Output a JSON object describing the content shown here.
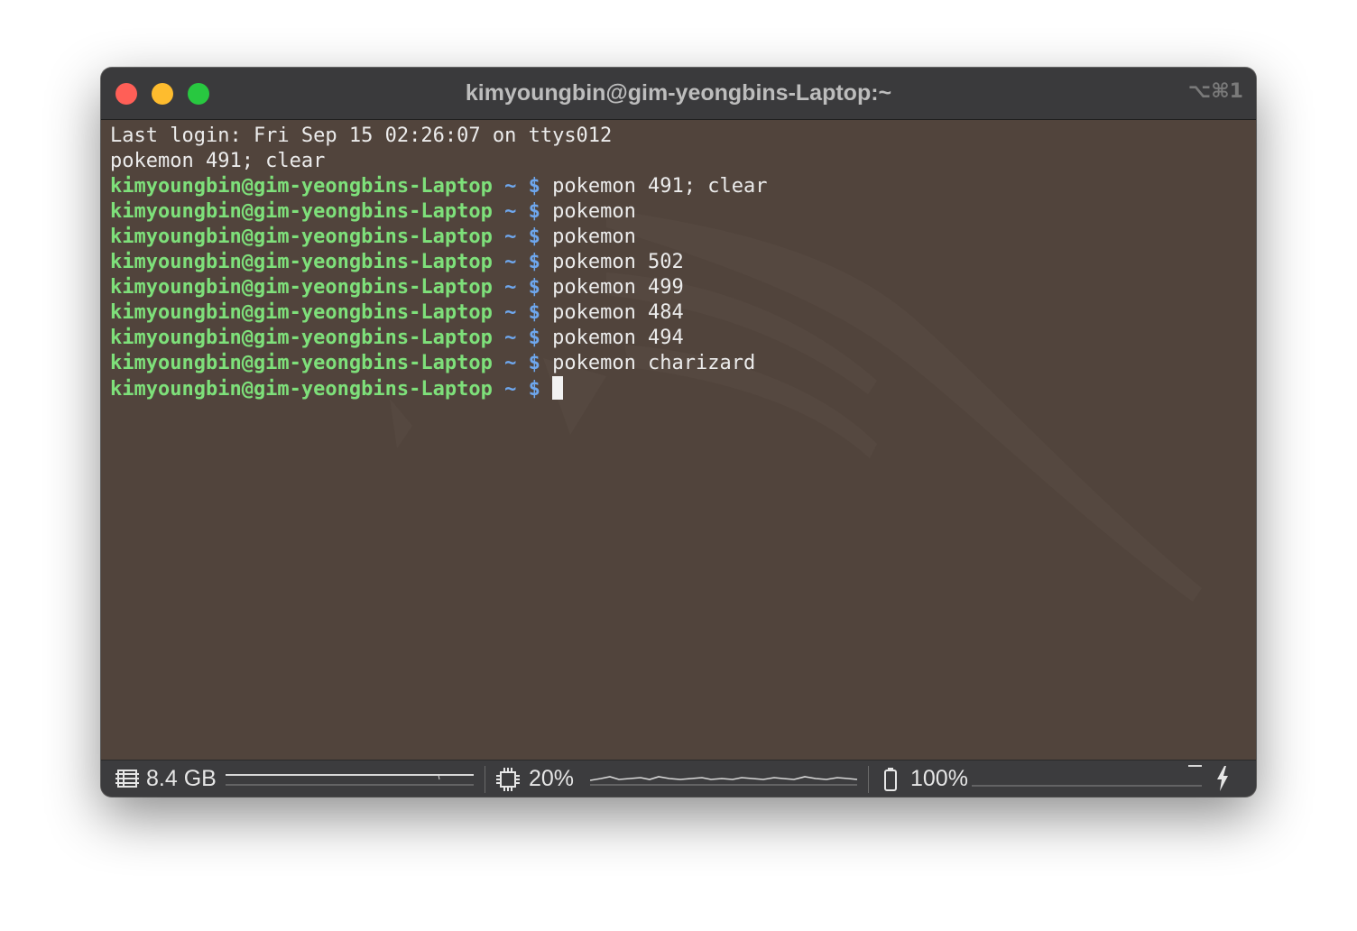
{
  "window": {
    "title": "kimyoungbin@gim-yeongbins-Laptop:~",
    "shortcut": "⌥⌘1",
    "traffic_lights": [
      "close",
      "minimize",
      "zoom"
    ]
  },
  "prompt": {
    "user_host": "kimyoungbin@gim-yeongbins-Laptop",
    "dir": "~",
    "symbol": "$"
  },
  "terminal": {
    "plain_lines": [
      "Last login: Fri Sep 15 02:26:07 on ttys012",
      "pokemon 491; clear"
    ],
    "commands": [
      "pokemon 491; clear",
      "pokemon",
      "pokemon",
      "pokemon 502",
      "pokemon 499",
      "pokemon 484",
      "pokemon 494",
      "pokemon charizard",
      ""
    ]
  },
  "status_bar": {
    "memory": {
      "icon": "memory-icon",
      "value": "8.4 GB"
    },
    "cpu": {
      "icon": "cpu-icon",
      "value": "20%"
    },
    "battery": {
      "icon": "battery-icon",
      "value": "100%",
      "charging_icon": "lightning-icon"
    }
  },
  "colors": {
    "background": "#51443c",
    "titlebar": "#3a3a3c",
    "prompt_user": "#7ee07a",
    "prompt_symbol": "#6ea7ee",
    "text": "#ececec",
    "close": "#ff5f57",
    "minimize": "#febc2e",
    "zoom": "#28c840"
  }
}
